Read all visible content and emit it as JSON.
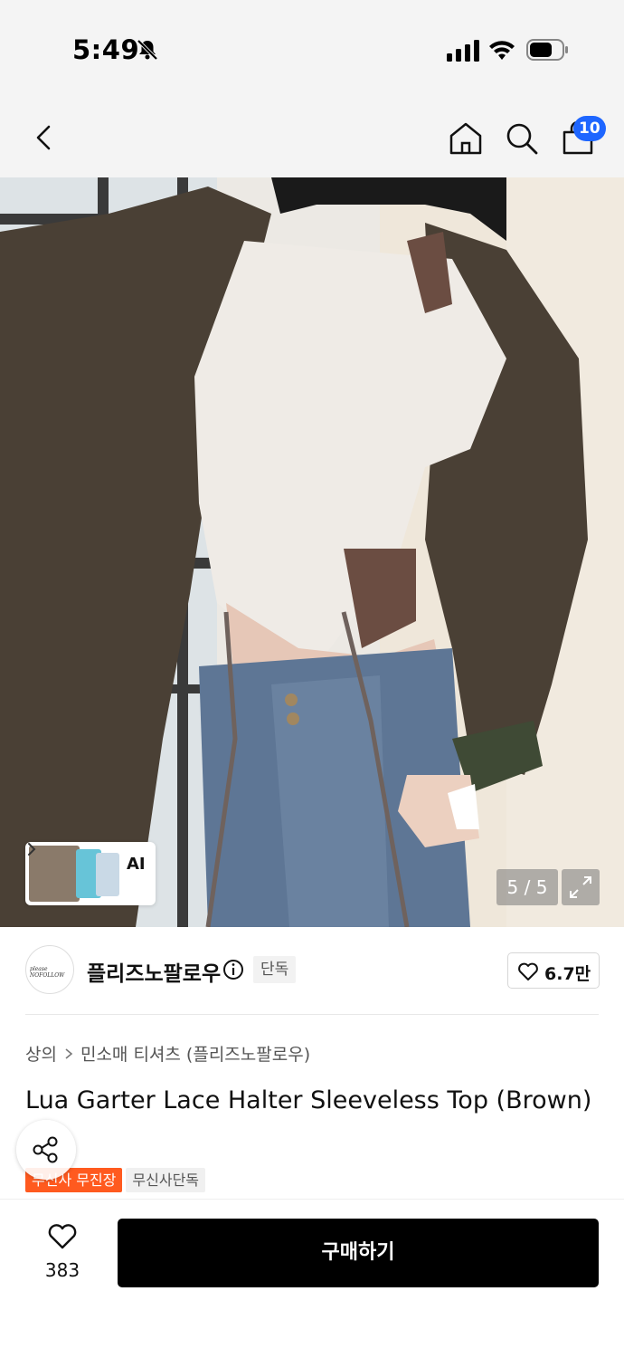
{
  "status_bar": {
    "time": "5:49"
  },
  "header": {
    "cart_badge": "10"
  },
  "product_image": {
    "page_indicator": "5 / 5",
    "ai_label": "AI"
  },
  "brand": {
    "name": "플리즈노팔로우",
    "logo_text": "please NOFOLLOW",
    "exclusive_badge": "단독",
    "like_count": "6.7만"
  },
  "breadcrumb": {
    "level1": "상의",
    "level2": "민소매 티셔츠 (플리즈노팔로우)"
  },
  "product": {
    "title": "Lua Garter Lace Halter Sleeveless Top (Brown)",
    "tags": [
      "무신사 무진장",
      "무신사단독"
    ]
  },
  "bottom_bar": {
    "wish_count": "383",
    "buy_label": "구매하기"
  },
  "colors": {
    "accent_blue": "#1e66ff",
    "tag_orange": "#ff5a1f",
    "buy_button": "#000000"
  }
}
